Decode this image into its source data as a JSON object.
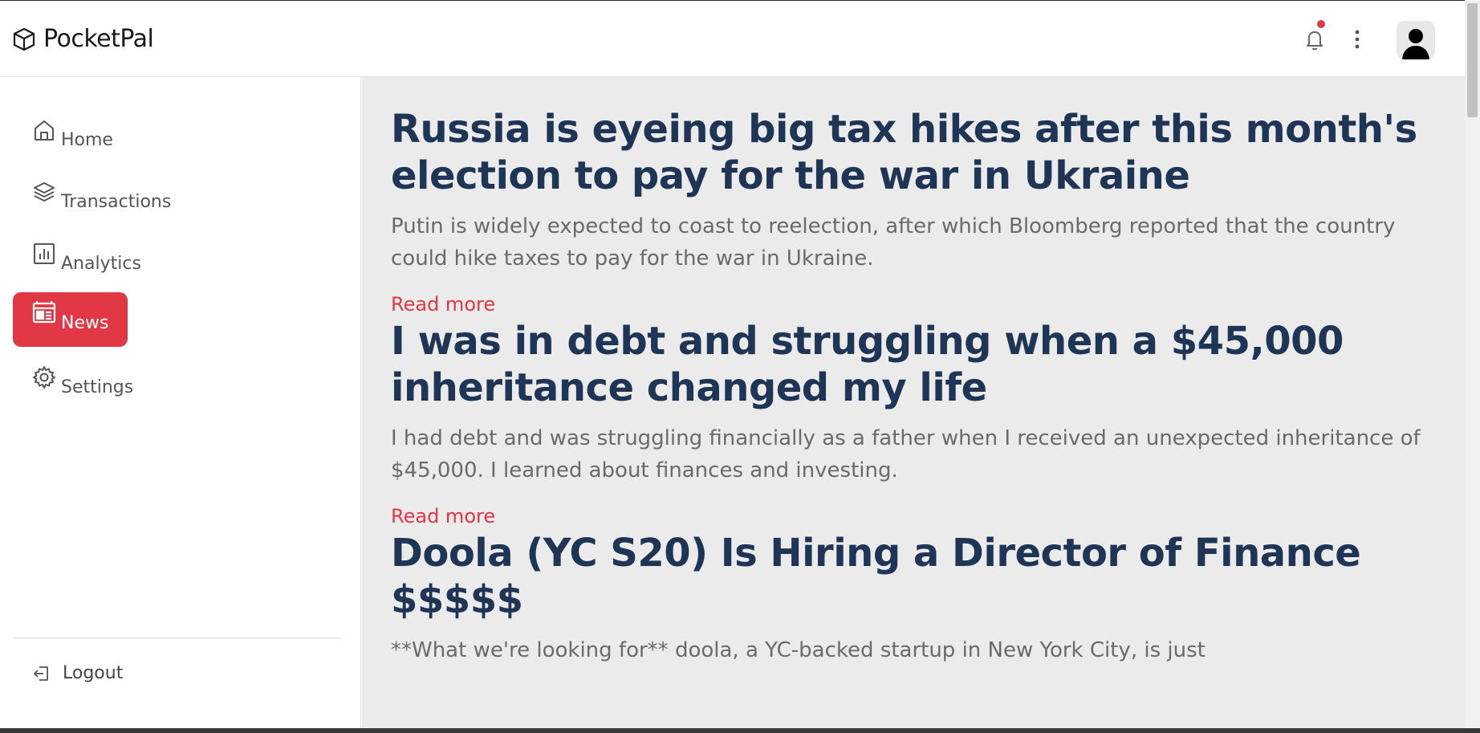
{
  "app": {
    "name": "PocketPal"
  },
  "topbar": {
    "notification_dot_color": "#e23744"
  },
  "sidebar": {
    "items": [
      {
        "label": "Home",
        "icon": "home-icon",
        "active": false
      },
      {
        "label": "Transactions",
        "icon": "layers-icon",
        "active": false
      },
      {
        "label": "Analytics",
        "icon": "bar-chart-icon",
        "active": false
      },
      {
        "label": "News",
        "icon": "newspaper-icon",
        "active": true
      },
      {
        "label": "Settings",
        "icon": "gear-icon",
        "active": false
      }
    ],
    "logout_label": "Logout"
  },
  "articles": [
    {
      "title": "Russia is eyeing big tax hikes after this month's election to pay for the war in Ukraine",
      "summary": "Putin is widely expected to coast to reelection, after which Bloomberg reported that the country could hike taxes to pay for the war in Ukraine.",
      "link_label": "Read more"
    },
    {
      "title": "I was in debt and struggling when a $45,000 inheritance changed my life",
      "summary": "I had debt and was struggling financially as a father when I received an unexpected inheritance of $45,000. I learned about finances and investing.",
      "link_label": "Read more"
    },
    {
      "title": "Doola (YC S20) Is Hiring a Director of Finance $$$$$",
      "summary": "**What we're looking for** doola, a YC-backed startup in New York City, is just"
    }
  ],
  "colors": {
    "accent": "#e23744",
    "headline": "#1f3556",
    "content_bg": "#ebebeb"
  }
}
